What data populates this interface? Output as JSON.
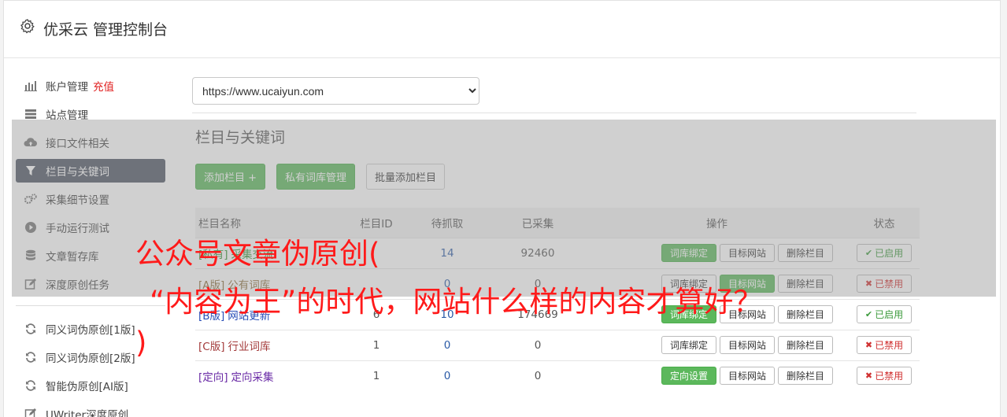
{
  "header": {
    "title": "优采云 管理控制台"
  },
  "sidebar": {
    "items": [
      {
        "label": "账户管理",
        "badge": "充值",
        "icon": "bar-chart-icon"
      },
      {
        "label": "站点管理",
        "icon": "server-icon"
      },
      {
        "label": "接口文件相关",
        "icon": "cloud-upload-icon"
      },
      {
        "label": "栏目与关键词",
        "icon": "filter-icon"
      },
      {
        "label": "采集细节设置",
        "icon": "gears-icon"
      },
      {
        "label": "手动运行测试",
        "icon": "play-circle-icon"
      },
      {
        "label": "文章暂存库",
        "icon": "database-icon"
      },
      {
        "label": "深度原创任务",
        "icon": "edit-icon"
      }
    ],
    "items2": [
      {
        "label": "同义词伪原创[1版]",
        "icon": "refresh-icon"
      },
      {
        "label": "同义词伪原创[2版]",
        "icon": "refresh-icon"
      },
      {
        "label": "智能伪原创[AI版]",
        "icon": "refresh-icon"
      },
      {
        "label": "UWriter深度原创",
        "icon": "edit-icon"
      }
    ]
  },
  "main": {
    "site_select": "https://www.ucaiyun.com",
    "section_title": "栏目与关键词",
    "buttons": {
      "add": "添加栏目 +",
      "private": "私有词库管理",
      "batch": "批量添加栏目"
    },
    "table": {
      "headers": [
        "栏目名称",
        "栏目ID",
        "待抓取",
        "已采集",
        "操作",
        "状态"
      ],
      "rows": [
        {
          "tag": "[私有]",
          "name": "采集交流",
          "id": "",
          "pending": "14",
          "collected": "92460",
          "bind": "词库绑定",
          "target": "目标网站",
          "delete": "删除栏目",
          "status": "已启用"
        },
        {
          "tag": "[A版]",
          "name": "公有词库",
          "id": "",
          "pending": "0",
          "collected": "0",
          "bind": "词库绑定",
          "target": "目标网站",
          "delete": "删除栏目",
          "status": "已禁用"
        },
        {
          "tag": "[B版]",
          "name": "网站更新",
          "id": "6",
          "pending": "10",
          "collected": "174669",
          "bind": "词库绑定",
          "target": "目标网站",
          "delete": "删除栏目",
          "status": "已启用"
        },
        {
          "tag": "[C版]",
          "name": "行业词库",
          "id": "1",
          "pending": "0",
          "collected": "0",
          "bind": "词库绑定",
          "target": "目标网站",
          "delete": "删除栏目",
          "status": "已禁用"
        },
        {
          "tag": "[定向]",
          "name": "定向采集",
          "id": "1",
          "pending": "0",
          "collected": "0",
          "bind": "定向设置",
          "target": "目标网站",
          "delete": "删除栏目",
          "status": "已禁用"
        }
      ]
    }
  },
  "overlay_caption": {
    "line1": "公众号文章伪原创(",
    "line2": "“内容为王”的时代，网站什么样的内容才算好？",
    "line3": ")"
  }
}
